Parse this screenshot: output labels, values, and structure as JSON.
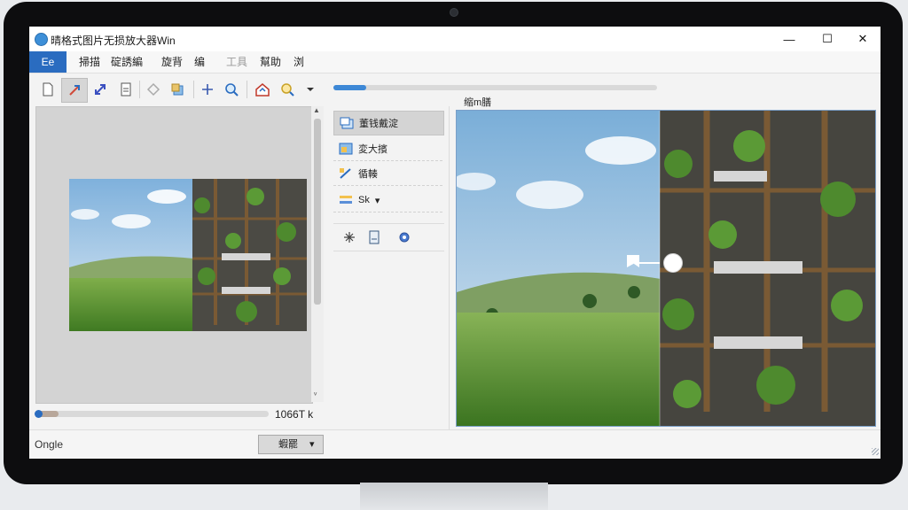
{
  "window": {
    "title": "晴格式图片无损放大器Win",
    "minimize": "—",
    "maximize": "☐",
    "close": "✕"
  },
  "menu": [
    "Ee",
    "掃描",
    "碇誘編",
    "旋背",
    "编",
    "工具",
    "幫助",
    "浏"
  ],
  "left_panel": {
    "zoom_value": "1066T",
    "zoom_suffix": "k",
    "scroll_up": "▲",
    "scroll_down": "ᵥ"
  },
  "status": {
    "left_text": "Ongle",
    "dropdown_label": "蝦罷",
    "dropdown_arrow": "▾"
  },
  "progress": {
    "top_fraction": 0.1,
    "bottom_fraction": 0.1
  },
  "actions": [
    {
      "label": "董钱戴淀"
    },
    {
      "label": "変大擯"
    },
    {
      "label": "循輳"
    },
    {
      "label": "Sk",
      "arrow": "▾"
    }
  ],
  "small_tools": [
    "snowflake-icon",
    "document-icon",
    "gear-icon"
  ],
  "compare": {
    "label": "缩m膳"
  },
  "colors": {
    "accent": "#2a6cc0",
    "progress": "#3d88d6"
  }
}
